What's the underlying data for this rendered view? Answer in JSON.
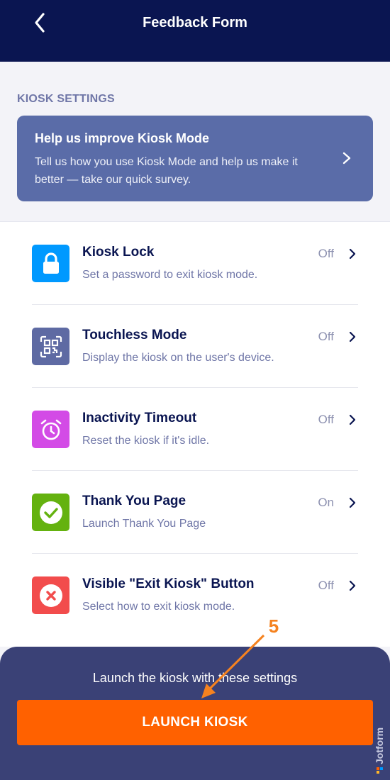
{
  "header": {
    "title": "Feedback Form",
    "back_icon": "chevron-left-icon"
  },
  "section": {
    "label": "KIOSK SETTINGS"
  },
  "survey": {
    "title": "Help us improve Kiosk Mode",
    "body": "Tell us how you use Kiosk Mode and help us make it better — take our quick survey.",
    "background": "#5a6ca8"
  },
  "settings": {
    "items": [
      {
        "title": "Kiosk Lock",
        "subtitle": "Set a password to exit kiosk mode.",
        "status": "Off",
        "icon": "lock-icon",
        "color": "#0099ff"
      },
      {
        "title": "Touchless Mode",
        "subtitle": "Display the kiosk on the user's device.",
        "status": "Off",
        "icon": "qr-code-icon",
        "color": "#5e6aa3"
      },
      {
        "title": "Inactivity Timeout",
        "subtitle": "Reset the kiosk if it's idle.",
        "status": "Off",
        "icon": "alarm-clock-icon",
        "color": "#d34be6"
      },
      {
        "title": "Thank You Page",
        "subtitle": "Launch Thank You Page",
        "status": "On",
        "icon": "check-circle-icon",
        "color": "#64b20f"
      },
      {
        "title": "Visible \"Exit Kiosk\" Button",
        "subtitle": "Select how to exit kiosk mode.",
        "status": "Off",
        "icon": "close-circle-icon",
        "color": "#f24c4c"
      }
    ]
  },
  "footer": {
    "text": "Launch the kiosk with these settings",
    "button_label": "LAUNCH KIOSK",
    "button_color": "#ff6100",
    "panel_color": "#3a4176"
  },
  "annotation": {
    "step": "5",
    "color": "#f5821f"
  },
  "brand": {
    "name": "Jotform"
  }
}
